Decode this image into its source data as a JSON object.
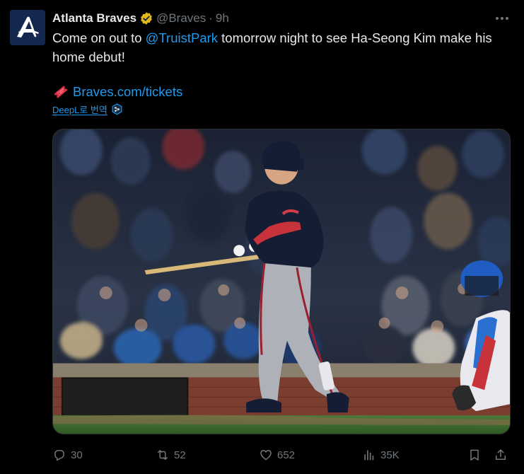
{
  "author": {
    "display_name": "Atlanta Braves",
    "handle": "@Braves",
    "time": "9h",
    "separator": "·"
  },
  "tweet": {
    "text_before": "Come on out to ",
    "mention": "@TruistPark",
    "text_after": " tomorrow night to see Ha-Seong Kim make his home debut!",
    "link": "Braves.com/tickets",
    "translate_label": "DeepL로 번역"
  },
  "metrics": {
    "replies": "30",
    "retweets": "52",
    "likes": "652",
    "views": "35K"
  },
  "icons": {
    "avatar": "braves-a-logo",
    "verified": "gold-verified-badge-icon",
    "more": "more-icon",
    "ticket": "ticket-emoji-icon",
    "translate": "deepl-icon",
    "reply": "reply-icon",
    "retweet": "retweet-icon",
    "like": "heart-icon",
    "views": "views-icon",
    "bookmark": "bookmark-icon",
    "share": "share-icon"
  },
  "colors": {
    "background": "#000000",
    "text": "#e7e9ea",
    "muted": "#71767b",
    "link": "#1d9bf0",
    "verified": "#e2b719",
    "braves_navy": "#13274f",
    "braves_red": "#ce1141"
  }
}
